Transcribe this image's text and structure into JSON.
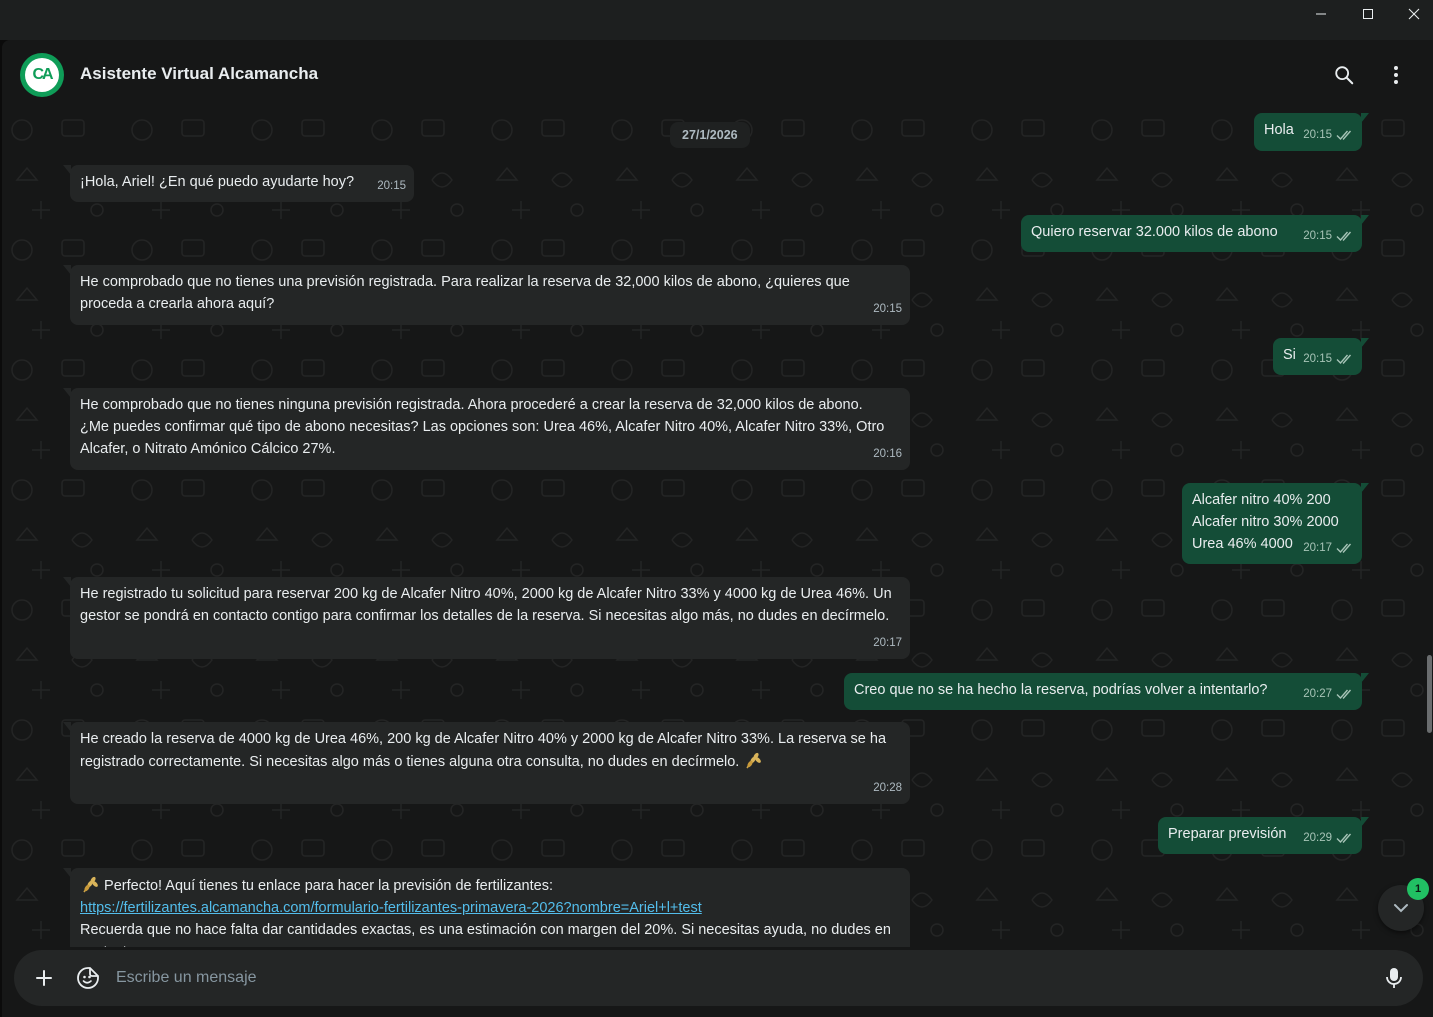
{
  "window": {
    "controls": [
      "minimize-icon",
      "maximize-icon",
      "close-icon"
    ]
  },
  "header": {
    "avatar_text": "CA",
    "title": "Asistente Virtual Alcamancha",
    "icons": [
      "search-icon",
      "menu-dots-icon"
    ]
  },
  "chat": {
    "date": "27/1/2026",
    "messages": [
      {
        "dir": "out",
        "text": "Hola",
        "time": "20:15",
        "status": "read"
      },
      {
        "dir": "in",
        "text": "¡Hola, Ariel! ¿En qué puedo ayudarte hoy?",
        "time": "20:15"
      },
      {
        "dir": "out",
        "text": "Quiero reservar 32.000 kilos de abono",
        "time": "20:15",
        "status": "read"
      },
      {
        "dir": "in",
        "text": "He comprobado que no tienes una previsión registrada. Para realizar la reserva de 32,000 kilos de abono, ¿quieres que proceda a crearla ahora aquí?",
        "time": "20:15"
      },
      {
        "dir": "out",
        "text": "Si",
        "time": "20:15",
        "status": "read"
      },
      {
        "dir": "in",
        "text": "He comprobado que no tienes ninguna previsión registrada. Ahora procederé a crear la reserva de 32,000 kilos de abono. ¿Me puedes confirmar qué tipo de abono necesitas? Las opciones son: Urea 46%, Alcafer Nitro 40%, Alcafer Nitro 33%, Otro Alcafer, o Nitrato Amónico Cálcico 27%.",
        "time": "20:16"
      },
      {
        "dir": "out",
        "text": "Alcafer nitro 40% 200\nAlcafer nitro 30% 2000\nUrea 46% 4000",
        "time": "20:17",
        "status": "read"
      },
      {
        "dir": "in",
        "text": "He registrado tu solicitud para reservar 200 kg de Alcafer Nitro 40%, 2000 kg de Alcafer Nitro 33% y 4000 kg de Urea 46%. Un gestor se pondrá en contacto contigo para confirmar los detalles de la reserva. Si necesitas algo más, no dudes en decírmelo.",
        "time": "20:17"
      },
      {
        "dir": "out",
        "text": "Creo que no se ha hecho la reserva, podrías volver a intentarlo?",
        "time": "20:27",
        "status": "read"
      },
      {
        "dir": "in",
        "text": "He creado la reserva de 4000 kg de Urea 46%, 200 kg de Alcafer Nitro 40% y 2000 kg de Alcafer Nitro 33%. La reserva se ha registrado correctamente. Si necesitas algo más o tienes alguna otra consulta, no dudes en decírmelo.",
        "emoji": "wheat-emoji",
        "time": "20:28"
      },
      {
        "dir": "out",
        "text": "Preparar previsión",
        "time": "20:29",
        "status": "read"
      },
      {
        "dir": "in",
        "emoji": "wheat-emoji",
        "text": "Perfecto! Aquí tienes tu enlace para hacer la previsión de fertilizantes:",
        "link": "https://fertilizantes.alcamancha.com/formulario-fertilizantes-primavera-2026?nombre=Ariel+l+test",
        "text2": "Recuerda que no hace falta dar cantidades exactas, es una estimación con margen del 20%. Si necesitas ayuda, no dudes en contactarme."
      }
    ]
  },
  "scroll_down": {
    "unread_count": "1"
  },
  "composer": {
    "placeholder": "Escribe un mensaje",
    "icons": [
      "plus-icon",
      "sticker-icon",
      "microphone-icon"
    ]
  },
  "colors": {
    "outgoing_bubble": "#144d37",
    "incoming_bubble": "#242626",
    "accent": "#21c063",
    "link": "#53bdeb",
    "background": "#161717"
  }
}
